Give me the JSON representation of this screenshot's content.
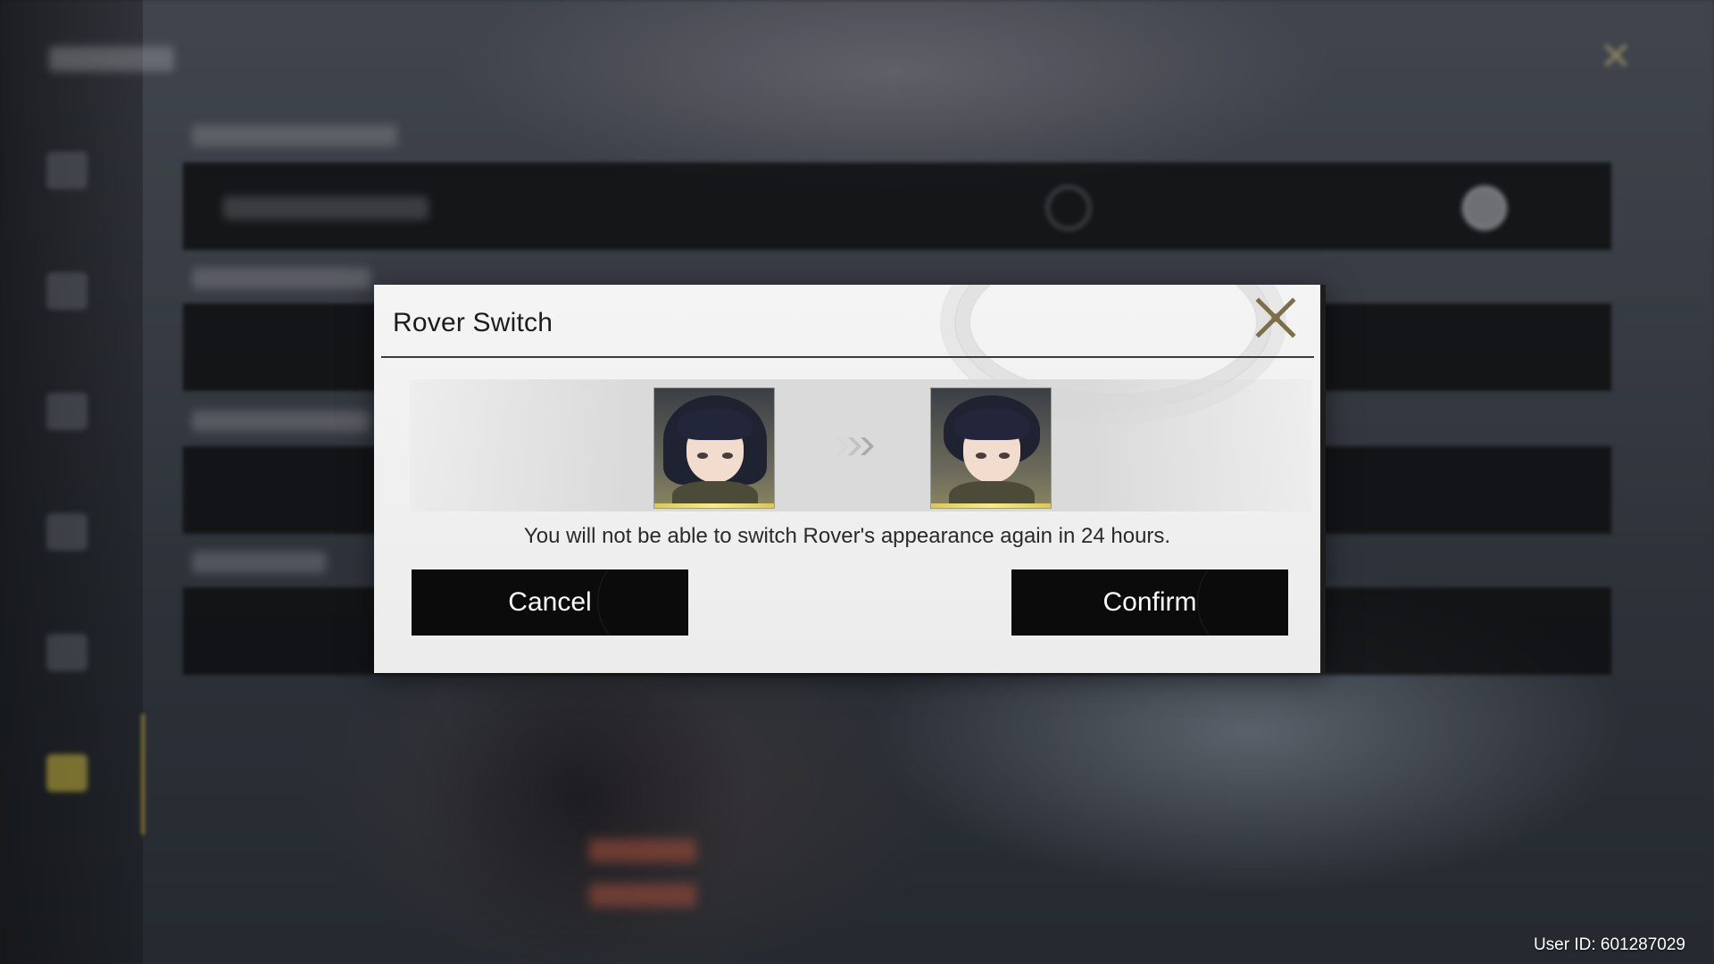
{
  "dialog": {
    "title": "Rover Switch",
    "message": "You will not be able to switch Rover's appearance again in 24 hours.",
    "cancel_label": "Cancel",
    "confirm_label": "Confirm",
    "close_icon": "close-x-icon",
    "from_portrait": "rover-female-portrait",
    "to_portrait": "rover-male-portrait",
    "arrow_icon": "triple-chevron-right-icon",
    "accent_color": "#8a7a4a"
  },
  "footer": {
    "user_id": "User ID: 601287029"
  },
  "colors": {
    "button_bg": "#0b0b0b",
    "button_text": "#ffffff",
    "dialog_bg": "#f0f0f0",
    "portrait_glow": "#f6ec8a"
  }
}
